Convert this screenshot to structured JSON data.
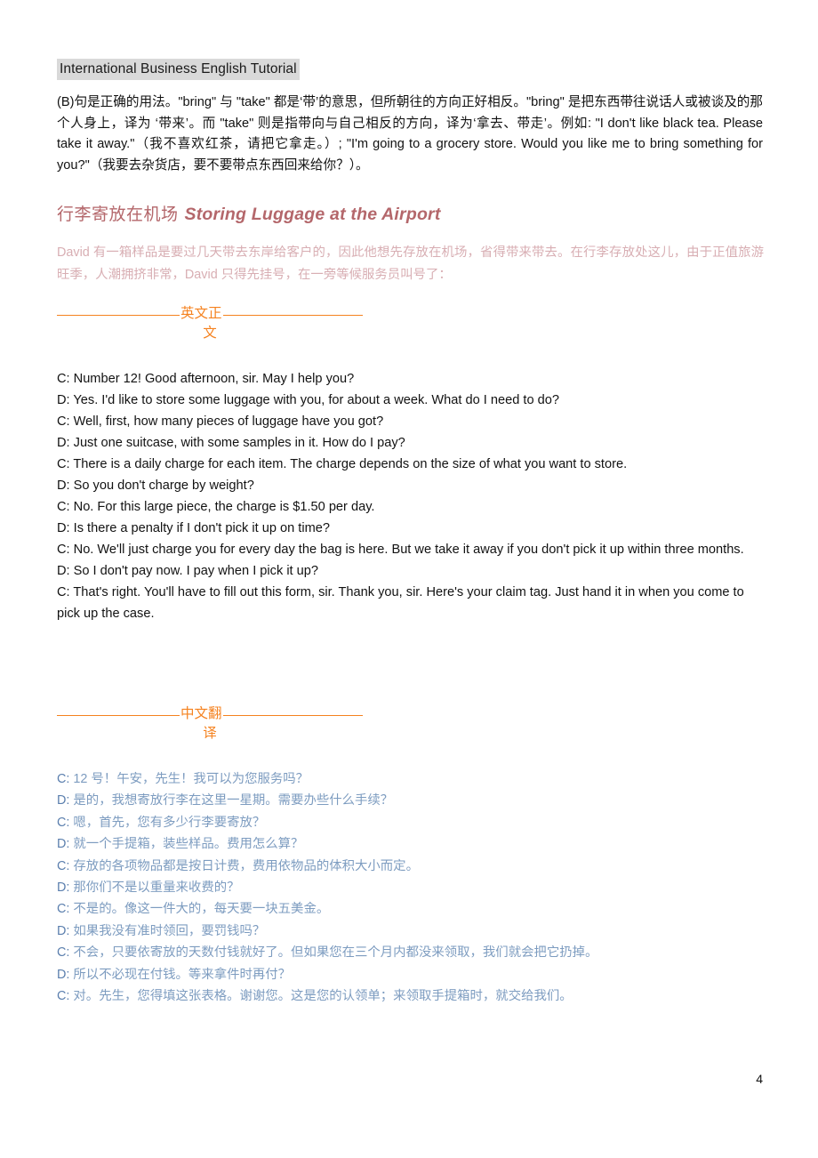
{
  "header": {
    "running_title": "International Business English Tutorial"
  },
  "note_paragraph": {
    "text": "(B)句是正确的用法。\"bring\" 与 \"take\" 都是‘带’的意思，但所朝往的方向正好相反。\"bring\" 是把东西带往说话人或被谈及的那个人身上，译为 ‘带来’。而 \"take\" 则是指带向与自己相反的方向，译为‘拿去、带走’。例如: \"I don't like black tea. Please take it away.\"（我不喜欢红茶，请把它拿走。）; \"I'm going to a grocery store. Would you like me to bring something for you?\"（我要去杂货店，要不要带点东西回来给你？）。"
  },
  "section": {
    "title_cn": "行李寄放在机场",
    "title_en": "Storing Luggage at the Airport",
    "title_color": "#b4676b",
    "intro": "David 有一箱样品是要过几天带去东岸给客户的，因此他想先存放在机场，省得带来带去。在行李存放处这儿，由于正值旅游旺季，人潮拥挤非常，David 只得先挂号，在一旁等候服务员叫号了：",
    "intro_color": "#d8aeb3"
  },
  "dividers": {
    "english_label_line1": "英文正",
    "english_label_line2": "文",
    "chinese_label_line1": "中文翻",
    "chinese_label_line2": "译",
    "color": "#f5821f"
  },
  "english_dialogue": {
    "lines": [
      "C: Number 12! Good afternoon, sir. May I help you?",
      "D: Yes. I'd like to store some luggage with you, for about a week. What do I need to do?",
      "C: Well, first, how many pieces of luggage have you got?",
      "D: Just one suitcase, with some samples in it. How do I pay?",
      "C: There is a daily charge for each item. The charge depends on the size of what you want to store.",
      "D: So you don't charge by weight?",
      "C: No. For this large piece, the charge is $1.50 per day.",
      "D: Is there a penalty if I don't pick it up on time?",
      "C: No. We'll just charge you for every day the bag is here. But we take it away if you don't pick it up within three months.",
      "D: So I don't pay now. I pay when I pick it up?",
      "C: That's right. You'll have to fill out this form, sir. Thank you, sir. Here's your claim tag. Just hand it in when you come to pick up the case."
    ]
  },
  "chinese_dialogue": {
    "color": "#7d9cc0",
    "lines": [
      {
        "speaker": "C:",
        "text": "12 号！午安，先生！我可以为您服务吗？"
      },
      {
        "speaker": "D:",
        "text": "是的，我想寄放行李在这里一星期。需要办些什么手续？"
      },
      {
        "speaker": "C:",
        "text": "嗯，首先，您有多少行李要寄放？"
      },
      {
        "speaker": "D:",
        "text": "就一个手提箱，装些样品。费用怎么算？"
      },
      {
        "speaker": "C:",
        "text": "存放的各项物品都是按日计费，费用依物品的体积大小而定。"
      },
      {
        "speaker": "D:",
        "text": "那你们不是以重量来收费的？"
      },
      {
        "speaker": "C:",
        "text": "不是的。像这一件大的，每天要一块五美金。"
      },
      {
        "speaker": "D:",
        "text": "如果我没有准时领回，要罚钱吗？"
      },
      {
        "speaker": "C:",
        "text": "不会，只要依寄放的天数付钱就好了。但如果您在三个月内都没来领取，我们就会把它扔掉。"
      },
      {
        "speaker": "D:",
        "text": "所以不必现在付钱。等来拿件时再付？"
      },
      {
        "speaker": "C:",
        "text": "对。先生，您得填这张表格。谢谢您。这是您的认领单；来领取手提箱时，就交给我们。"
      }
    ]
  },
  "footer": {
    "page_number": "4"
  }
}
